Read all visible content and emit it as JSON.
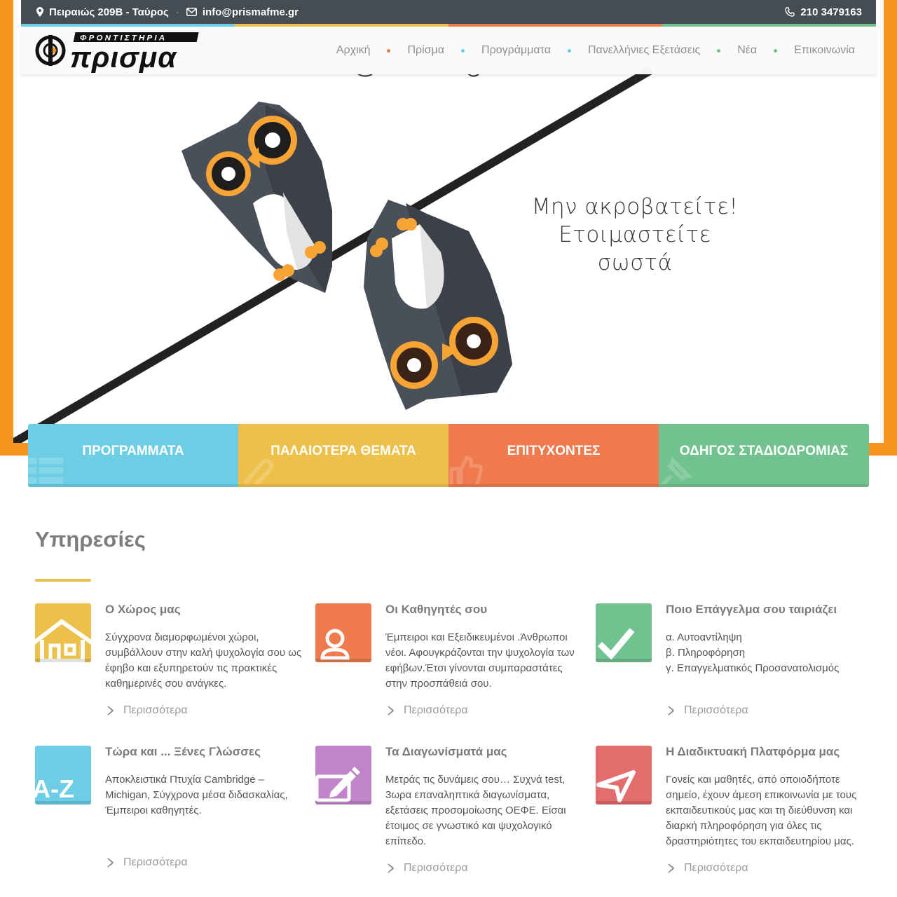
{
  "topbar": {
    "address": "Πειραιώς 209Β - Ταύρος",
    "email": "info@prismafme.gr",
    "phone": "210 3479163"
  },
  "logo": {
    "top_text": "ΦΡΟΝΤΙΣΤΗΡΙΑ",
    "main_text": "πρισμα"
  },
  "nav": {
    "items": [
      "Αρχική",
      "Πρίσμα",
      "Προγράμματα",
      "Πανελλήνιες Εξετάσεις",
      "Νέα",
      "Επικοινωνία"
    ],
    "separator_colors": [
      "#ee7a4d",
      "#6ccde5",
      "#6ccde5",
      "#72c28f",
      "#72c28f"
    ]
  },
  "hero": {
    "line1": "Μην ακροβατείτε!",
    "line2": "Ετοιμαστείτε σωστά"
  },
  "tiles": [
    {
      "label": "ΠΡΟΓΡΑΜΜΑΤΑ",
      "color": "#6ccde5",
      "icon": "list-icon"
    },
    {
      "label": "ΠΑΛΑΙΟΤΕΡΑ ΘΕΜΑΤΑ",
      "color": "#ecc04a",
      "icon": "paperclip-icon"
    },
    {
      "label": "ΕΠΙΤΥΧΟΝΤΕΣ",
      "color": "#ee7a4d",
      "icon": "thumbs-up-icon"
    },
    {
      "label": "ΟΔΗΓΟΣ ΣΤΑΔΙΟΔΡΟΜΙΑΣ",
      "color": "#72c28f",
      "icon": "pin-icon"
    }
  ],
  "services": {
    "title": "Υπηρεσίες",
    "more_label": "Περισσότερα",
    "items": [
      {
        "title": "Ο Χώρος μας",
        "text": "Σύγχρονα διαμορφωμένοι χώροι, συμβάλλουν στην καλή ψυχολογία σου ως έφηβο και εξυπηρετούν τις πρακτικές καθημερινές σου ανάγκες.",
        "color": "#ecc04a",
        "icon": "home-icon"
      },
      {
        "title": "Οι Καθηγητές σου",
        "text": "Έμπειροι και Εξειδικευμένοι .Άνθρωποι νέοι. Αφουγκράζονται την ψυχολογία των εφήβων.Έτσι γίνονται συμπαραστάτες στην προσπάθειά σου.",
        "color": "#ee7a4d",
        "icon": "user-icon"
      },
      {
        "title": "Ποιο Επάγγελμα σου ταιριάζει",
        "text_lines": [
          "α. Αυτοαντίληψη",
          "β. Πληροφόρηση",
          "γ. Επαγγελματικός Προσανατολισμός"
        ],
        "color": "#72c28f",
        "icon": "check-icon"
      },
      {
        "title": "Τώρα και ... Ξένες Γλώσσες",
        "text": "Αποκλειστικά Πτυχία Cambridge – Michigan, Σύγχρονα μέσα διδασκαλίας, Έμπειροι καθηγητές.",
        "color": "#6ccde5",
        "icon": "a-z-icon",
        "icon_text": "A-Z"
      },
      {
        "title": "Τα Διαγωνίσματά μας",
        "text": "Μετράς τις δυνάμεις σου… Συχνά test, 3ωρα επαναληπτικά διαγωνίσματα, εξετάσεις προσομοίωσης ΟΕΦΕ. Είσαι έτοιμος σε γνωστικό και ψυχολογικό επίπεδο.",
        "color": "#c084c9",
        "icon": "edit-icon"
      },
      {
        "title": "Η Διαδικτυακή Πλατφόρμα μας",
        "text": "Γονείς και μαθητές, από οποιοδήποτε σημείο, έχουν άμεση επικοινωνία με τους εκπαιδευτικούς μας και τη διεύθυνση και διαρκή πληροφόρηση για όλες τις δραστηριότητες του εκπαιδευτηρίου μας.",
        "color": "#e36c6c",
        "icon": "send-icon"
      }
    ]
  }
}
